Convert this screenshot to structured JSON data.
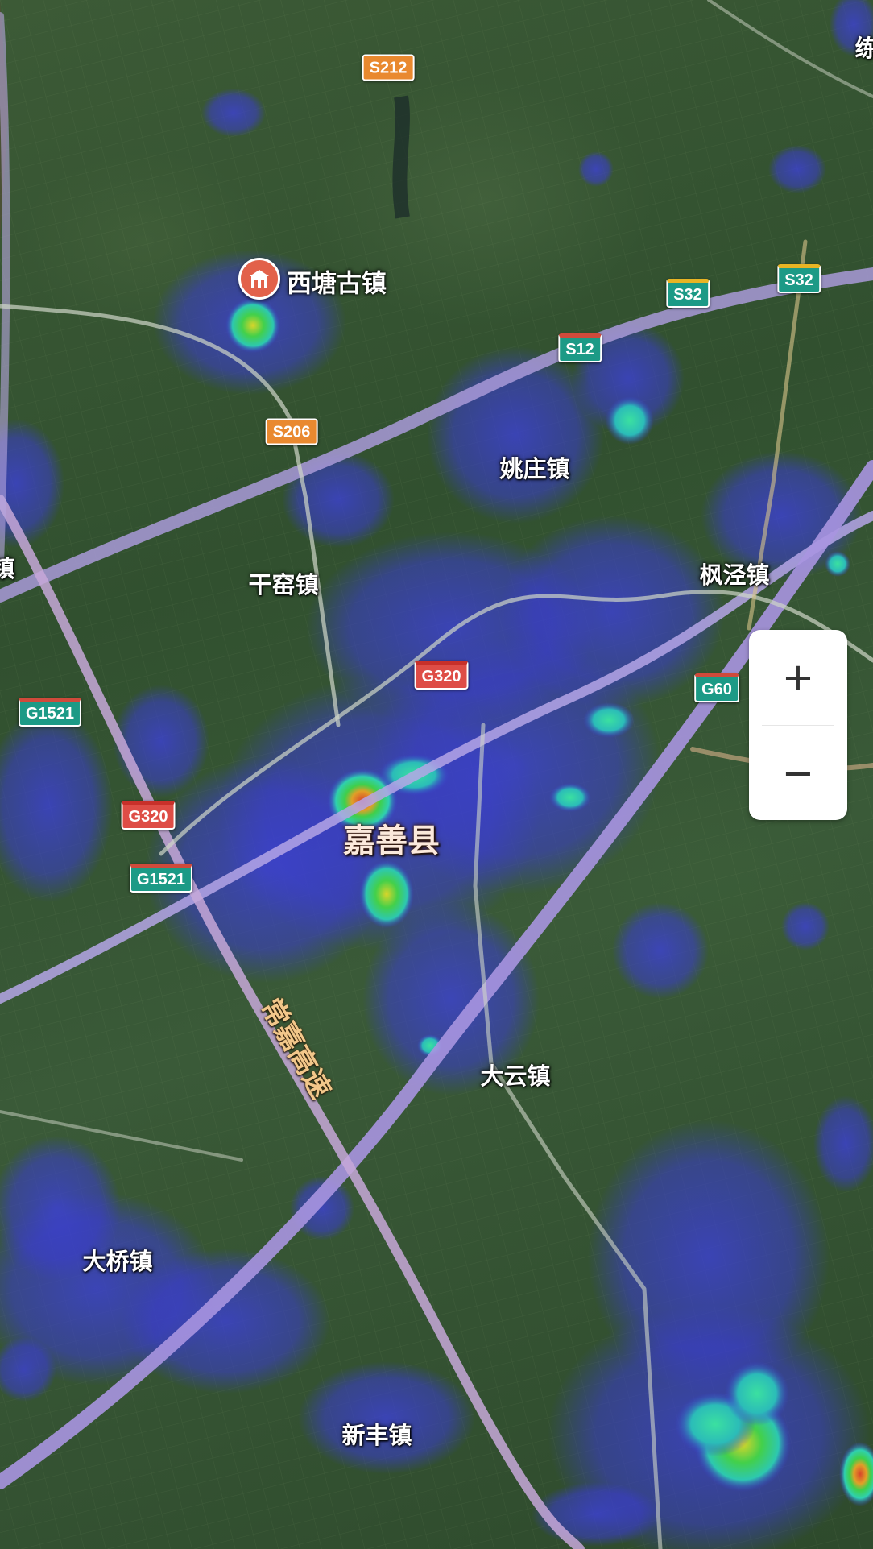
{
  "map": {
    "poi": {
      "name": "西塘古镇",
      "icon": "ancient-town-icon",
      "color": "#e2614a"
    },
    "places": [
      {
        "id": "yaozhuang",
        "name": "姚庄镇"
      },
      {
        "id": "ganyao",
        "name": "干窑镇"
      },
      {
        "id": "fengjing",
        "name": "枫泾镇"
      },
      {
        "id": "jiashan",
        "name": "嘉善县"
      },
      {
        "id": "dayun",
        "name": "大云镇"
      },
      {
        "id": "daqiao",
        "name": "大桥镇"
      },
      {
        "id": "xinfeng",
        "name": "新丰镇"
      },
      {
        "id": "edge-left",
        "name": "镇"
      },
      {
        "id": "edge-topright",
        "name": "练"
      }
    ],
    "shields": [
      {
        "id": "s212",
        "label": "S212",
        "style": "orange"
      },
      {
        "id": "s206",
        "label": "S206",
        "style": "orange"
      },
      {
        "id": "s12",
        "label": "S12",
        "style": "green"
      },
      {
        "id": "s32a",
        "label": "S32",
        "style": "teal"
      },
      {
        "id": "s32b",
        "label": "S32",
        "style": "teal"
      },
      {
        "id": "g320a",
        "label": "G320",
        "style": "red"
      },
      {
        "id": "g320b",
        "label": "G320",
        "style": "red"
      },
      {
        "id": "g60",
        "label": "G60",
        "style": "green"
      },
      {
        "id": "g1521a",
        "label": "G1521",
        "style": "green"
      },
      {
        "id": "g1521b",
        "label": "G1521",
        "style": "green"
      }
    ],
    "expressway_label": "常嘉高速",
    "heat_colors": {
      "low": "#3a3fd6",
      "mid": "#2fd6a8",
      "high": "#d8e02a",
      "peak": "#d8452a"
    },
    "road_color": "#b7a6e0"
  },
  "zoom_controls": {
    "zoom_in": "+",
    "zoom_out": "−"
  }
}
